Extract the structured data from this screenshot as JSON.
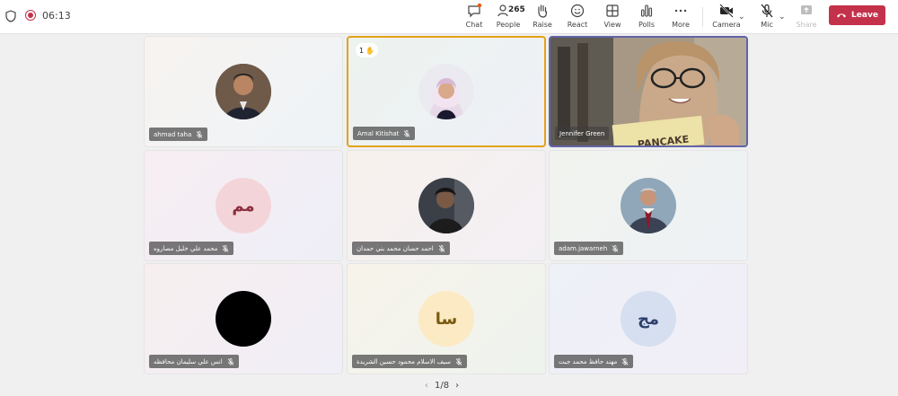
{
  "status": {
    "timer": "06:13"
  },
  "toolbar": {
    "chat": "Chat",
    "people": "People",
    "people_count": "265",
    "raise": "Raise",
    "react": "React",
    "view": "View",
    "polls": "Polls",
    "more": "More",
    "camera": "Camera",
    "mic": "Mic",
    "share": "Share",
    "leave": "Leave"
  },
  "tiles": [
    {
      "name": "ahmad taha"
    },
    {
      "name": "Amal Kitishat",
      "hand_count": "1",
      "hand_icon": "✋"
    },
    {
      "name": "Jennifer Green",
      "video_text": "PANCAKE"
    },
    {
      "name": "محمد علي خليل مصاروه",
      "initials": "مم"
    },
    {
      "name": "احمد حسان محمد بني حمدان"
    },
    {
      "name": "adam.jawarneh"
    },
    {
      "name": "انس علي سليمان محافظه"
    },
    {
      "name": "سيف الاسلام محمود حسين الشريدة",
      "initials": "سا"
    },
    {
      "name": "مهند حافظ محمد جبت",
      "initials": "مج"
    }
  ],
  "pager": {
    "prev": "‹",
    "label": "1/8",
    "next": "›"
  },
  "colors": {
    "leave": "#c4314b",
    "active_speaker": "#e3a21a",
    "pinned": "#6264a7"
  }
}
